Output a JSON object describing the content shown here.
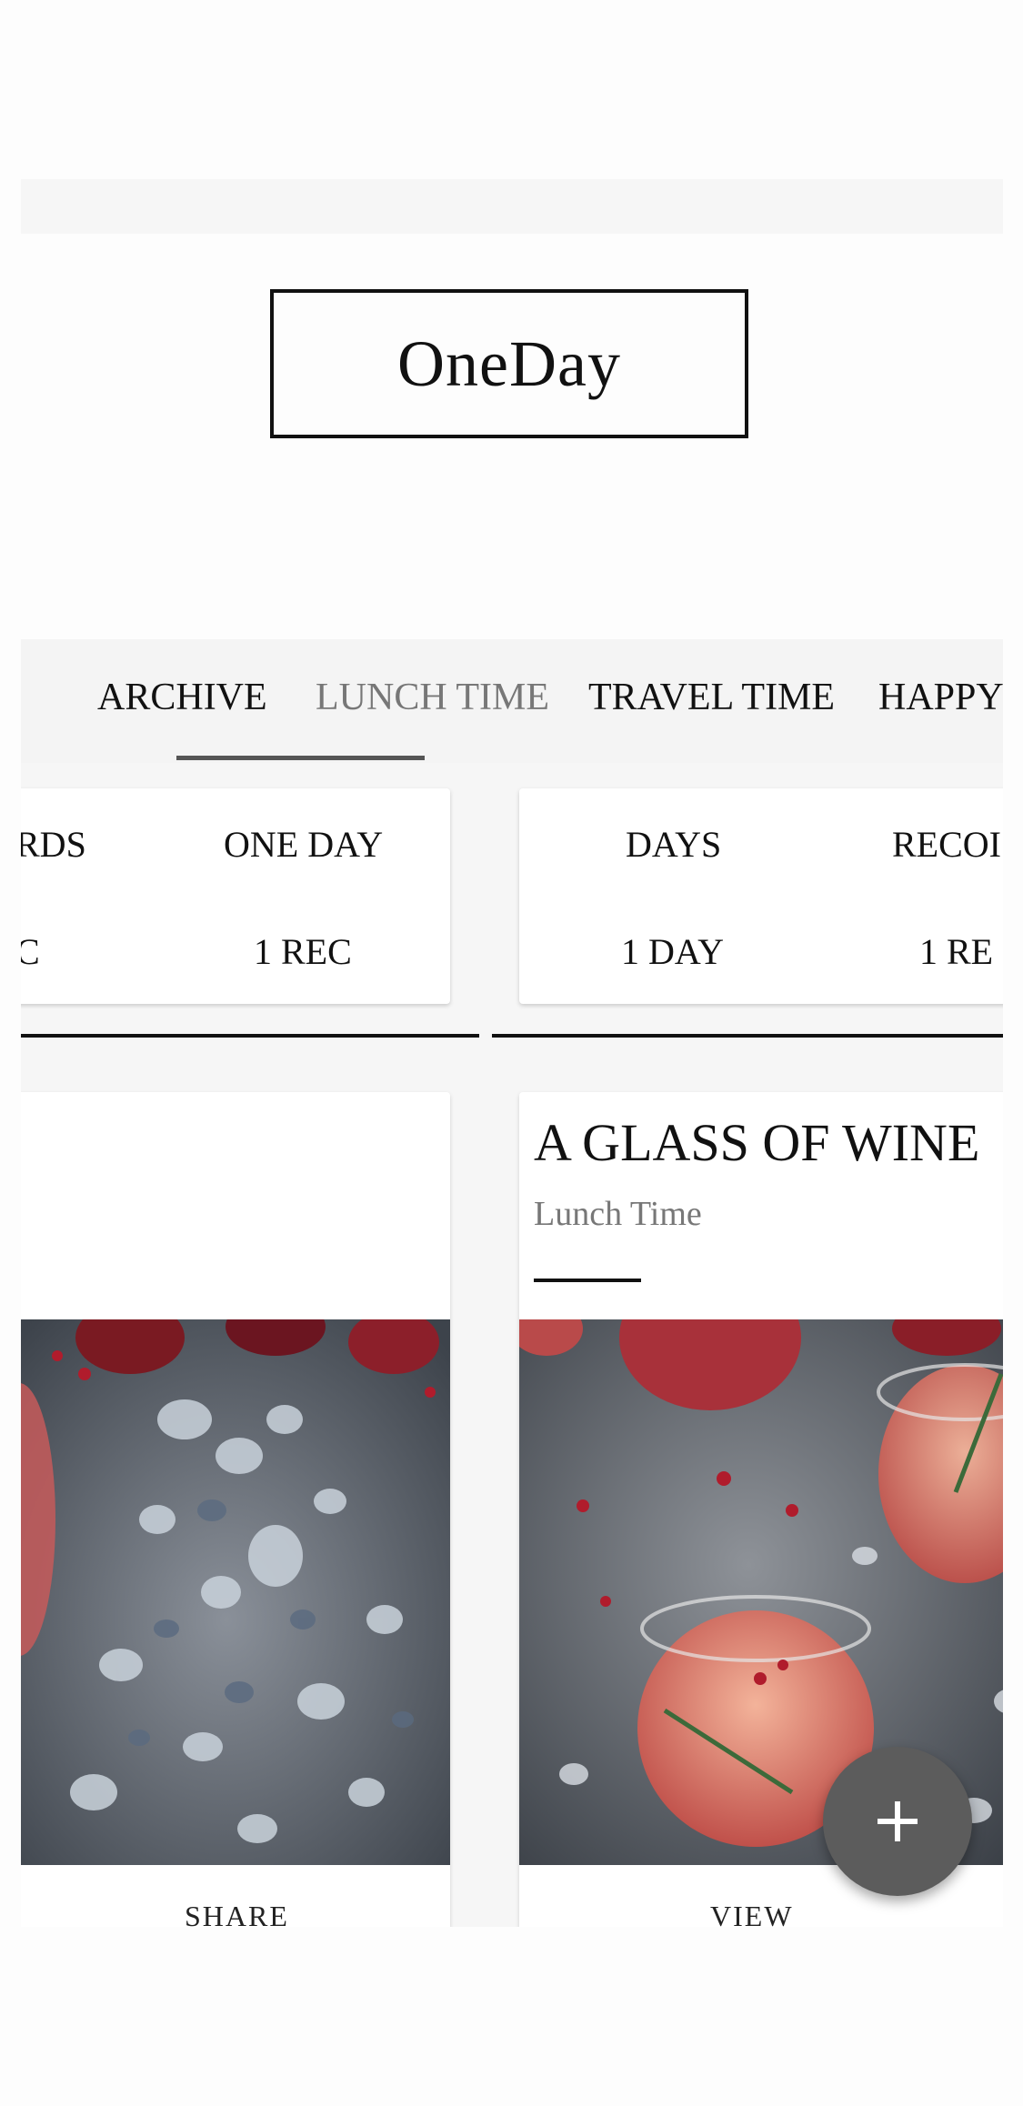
{
  "app": {
    "logo": "OneDay"
  },
  "tabs": [
    {
      "label": "ARCHIVE"
    },
    {
      "label": "LUNCH TIME",
      "active": true
    },
    {
      "label": "TRAVEL TIME"
    },
    {
      "label": "HAPPY"
    }
  ],
  "stats_left": {
    "label_a": "RDS",
    "value_a": "C",
    "label_b": "ONE DAY",
    "value_b": "1 REC"
  },
  "stats_right": {
    "label_a": "DAYS",
    "value_a": "1 DAY",
    "label_b": "RECOI",
    "value_b": "1 RE"
  },
  "cards": {
    "left": {
      "action": "SHARE"
    },
    "right": {
      "title": "A GLASS OF WINE",
      "subtitle": "Lunch Time",
      "action": "VIEW"
    }
  },
  "fab": {
    "icon": "plus-icon"
  },
  "colors": {
    "accent": "#5c5c5c",
    "text": "#111111",
    "muted": "#777777"
  }
}
